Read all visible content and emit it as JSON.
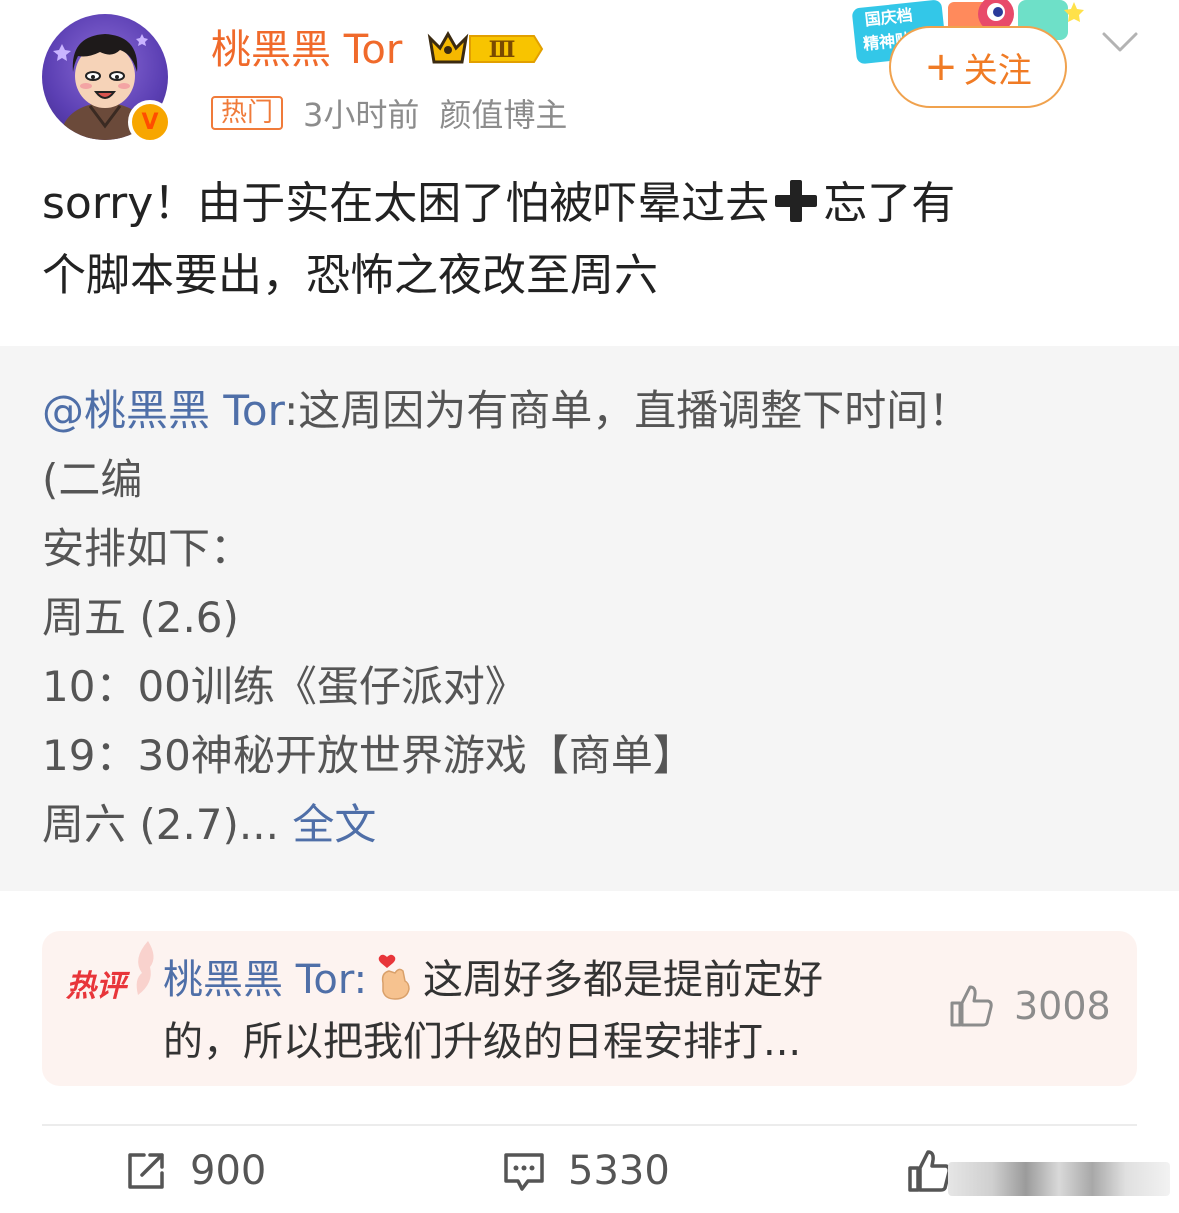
{
  "header": {
    "username": "桃黑黑 Tor",
    "vip_level": "Ⅲ",
    "hot_tag": "热门",
    "time": "3小时前",
    "user_title": "颜值博主",
    "follow_label": "关注",
    "campaign_text": "国庆档 精神贴"
  },
  "post": {
    "line1_before": "sorry！由于实在太困了怕被吓晕过去",
    "line1_after": "忘了有",
    "line2": "个脚本要出，恐怖之夜改至周六"
  },
  "repost": {
    "mention": "@桃黑黑 Tor",
    "line1": ":这周因为有商单，直播调整下时间！",
    "line2": "(二编",
    "line3": "安排如下：",
    "line4": "周五 (2.6)",
    "line5": "10：00训练《蛋仔派对》",
    "line6": "19：30神秘开放世界游戏【商单】",
    "line7": "周六 (2.7)...",
    "fulltext_label": "全文"
  },
  "hot_comment": {
    "label": "热评",
    "author": "桃黑黑 Tor:",
    "text_part1": "这周好多都是提前定好",
    "text_part2": "的，所以把我们升级的日程安排打...",
    "like_count": "3008"
  },
  "actions": {
    "repost_count": "900",
    "comment_count": "5330"
  },
  "colors": {
    "username": "#f06a2b",
    "link": "#4f6fa8",
    "hot_red": "#e8353a",
    "repost_bg": "#f5f5f5"
  }
}
